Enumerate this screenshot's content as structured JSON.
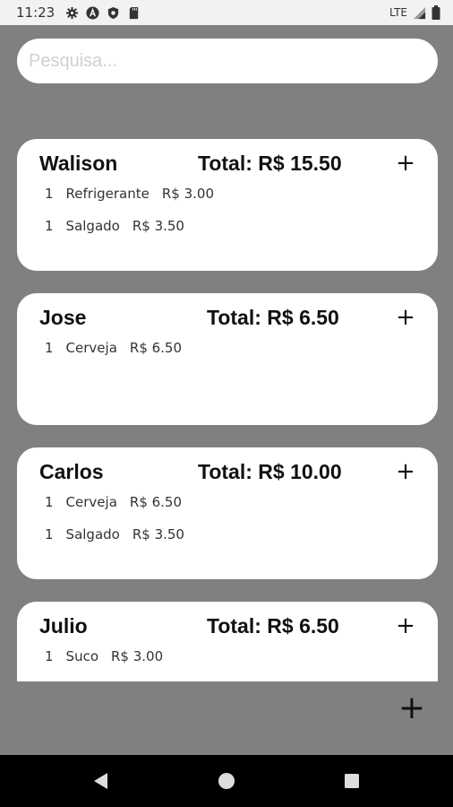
{
  "status_bar": {
    "time": "11:23",
    "network": "LTE",
    "icons": [
      "settings-icon",
      "a-icon",
      "shield-icon",
      "sd-card-icon",
      "signal-icon",
      "battery-icon"
    ]
  },
  "search": {
    "placeholder": "Pesquisa...",
    "value": ""
  },
  "orders": [
    {
      "name": "Walison",
      "total": "Total: R$ 15.50",
      "items": [
        {
          "qty": "1",
          "product": "Refrigerante",
          "price": "R$ 3.00"
        },
        {
          "qty": "1",
          "product": "Salgado",
          "price": "R$ 3.50"
        }
      ]
    },
    {
      "name": "Jose",
      "total": "Total: R$ 6.50",
      "items": [
        {
          "qty": "1",
          "product": "Cerveja",
          "price": "R$ 6.50"
        }
      ]
    },
    {
      "name": "Carlos",
      "total": "Total: R$ 10.00",
      "items": [
        {
          "qty": "1",
          "product": "Cerveja",
          "price": "R$ 6.50"
        },
        {
          "qty": "1",
          "product": "Salgado",
          "price": "R$ 3.50"
        }
      ]
    },
    {
      "name": "Julio",
      "total": "Total: R$ 6.50",
      "items": [
        {
          "qty": "1",
          "product": "Suco",
          "price": "R$ 3.00"
        }
      ]
    }
  ],
  "add_symbol": "+",
  "fab_symbol": "+",
  "navbar": {
    "icons": [
      "back-icon",
      "home-icon",
      "recents-icon"
    ]
  }
}
